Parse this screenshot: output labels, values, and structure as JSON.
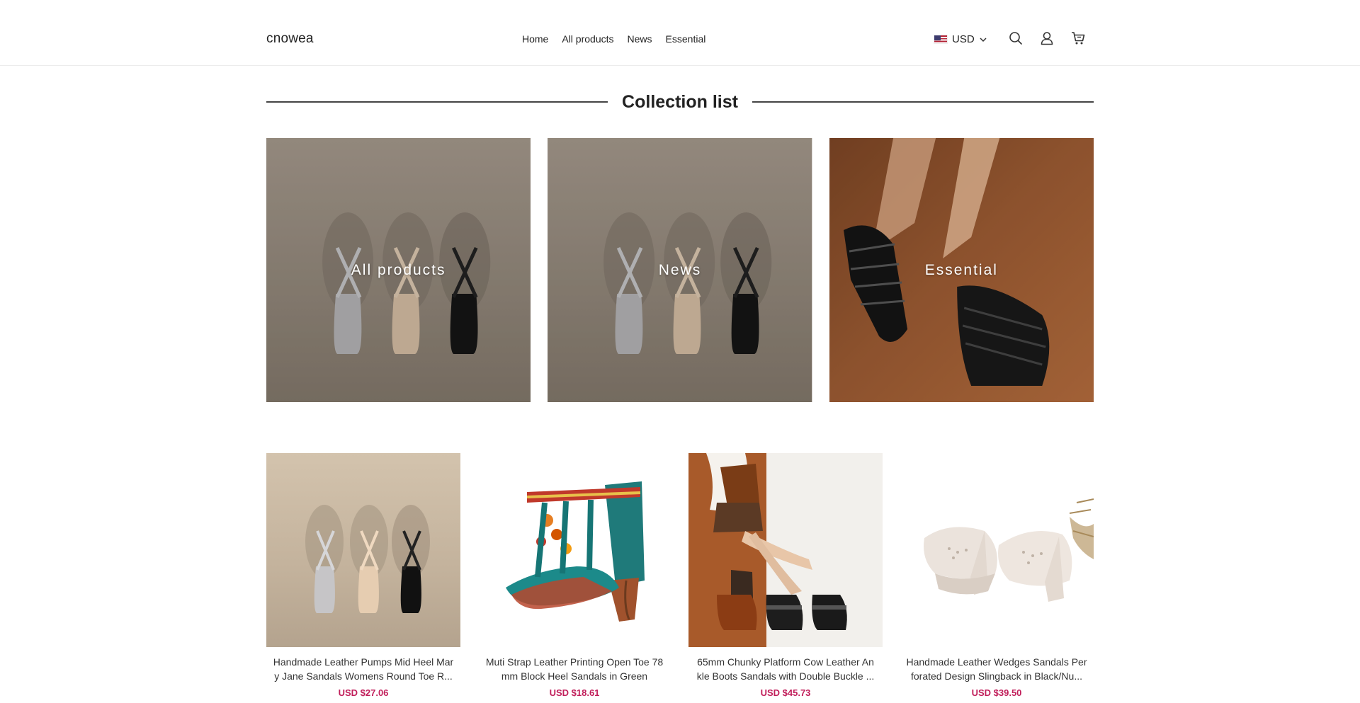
{
  "header": {
    "logo": "cnowea",
    "nav": [
      "Home",
      "All products",
      "News",
      "Essential"
    ],
    "currency": "USD",
    "icons": [
      "search-icon",
      "account-icon",
      "cart-icon"
    ]
  },
  "collection_section": {
    "title": "Collection list",
    "items": [
      {
        "label": "All products"
      },
      {
        "label": "News"
      },
      {
        "label": "Essential"
      }
    ]
  },
  "products": [
    {
      "title": "Handmade Leather Pumps Mid Heel Mary Jane Sandals Womens Round Toe R...",
      "price": "USD $27.06"
    },
    {
      "title": "Muti Strap Leather Printing Open Toe 78mm Block Heel Sandals in Green",
      "price": "USD $18.61"
    },
    {
      "title": "65mm Chunky Platform Cow Leather Ankle Boots Sandals with Double Buckle ...",
      "price": "USD $45.73"
    },
    {
      "title": "Handmade Leather Wedges Sandals Perforated Design Slingback in Black/Nu...",
      "price": "USD $39.50"
    }
  ],
  "colors": {
    "price": "#c11f5b",
    "divider": "#444444"
  }
}
